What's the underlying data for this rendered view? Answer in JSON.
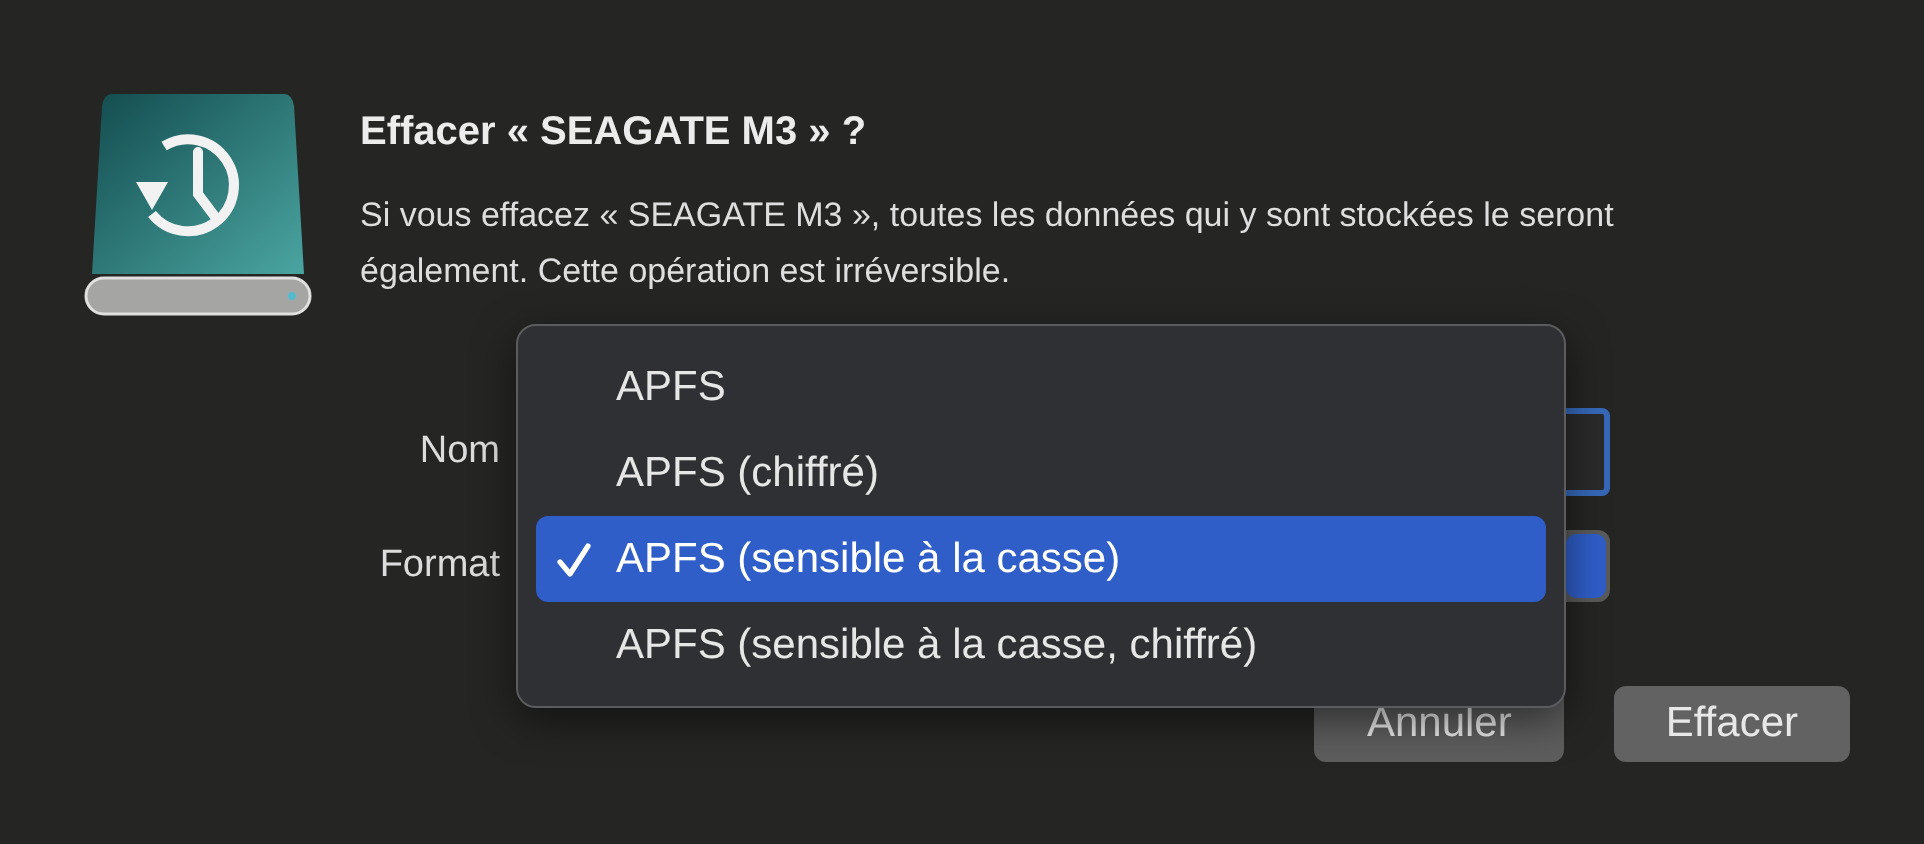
{
  "dialog": {
    "title": "Effacer « SEAGATE M3 » ?",
    "message": "Si vous effacez « SEAGATE M3 », toutes les données qui y sont stockées le seront également. Cette opération est irréversible."
  },
  "form": {
    "fields": [
      {
        "label": "Nom",
        "kind": "text"
      },
      {
        "label": "Format",
        "kind": "popup"
      }
    ]
  },
  "buttons": [
    {
      "label": "Annuler"
    },
    {
      "label": "Effacer"
    }
  ],
  "menu": {
    "items": [
      {
        "label": "APFS",
        "selected": false
      },
      {
        "label": "APFS (chiffré)",
        "selected": false
      },
      {
        "label": "APFS (sensible à la casse)",
        "selected": true
      },
      {
        "label": "APFS (sensible à la casse, chiffré)",
        "selected": false
      }
    ]
  }
}
